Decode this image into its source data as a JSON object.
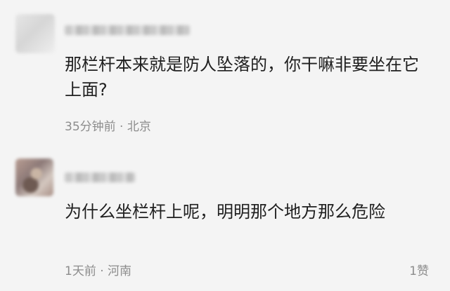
{
  "comments": [
    {
      "text": "那栏杆本来就是防人坠落的，你干嘛非要坐在它上面?",
      "time": "35分钟前",
      "separator": "·",
      "location": "北京"
    },
    {
      "text": "为什么坐栏杆上呢，明明那个地方那么危险",
      "time": "1天前",
      "separator": "·",
      "location": "河南",
      "likes": "1赞"
    }
  ]
}
